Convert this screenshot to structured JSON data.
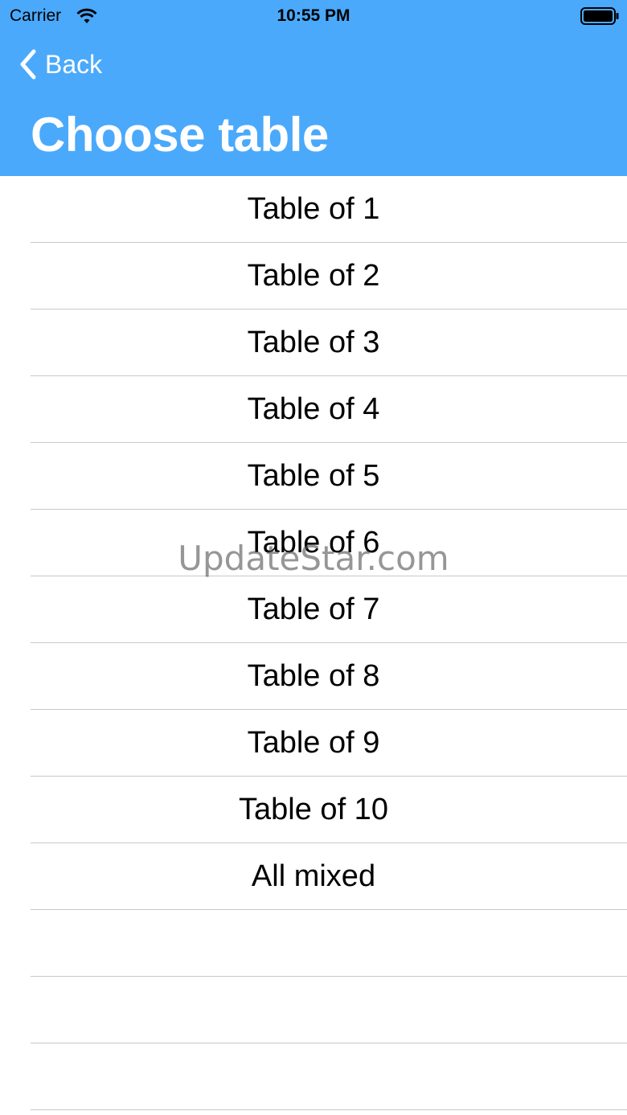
{
  "status_bar": {
    "carrier": "Carrier",
    "time": "10:55 PM"
  },
  "nav": {
    "back_label": "Back",
    "title": "Choose table"
  },
  "colors": {
    "header": "#4aa9fb",
    "separator": "#c8c7cc"
  },
  "rows": [
    "Table of 1",
    "Table of 2",
    "Table of 3",
    "Table of 4",
    "Table of 5",
    "Table of 6",
    "Table of 7",
    "Table of 8",
    "Table of 9",
    "Table of 10",
    "All mixed"
  ],
  "watermark": "UpdateStar.com"
}
